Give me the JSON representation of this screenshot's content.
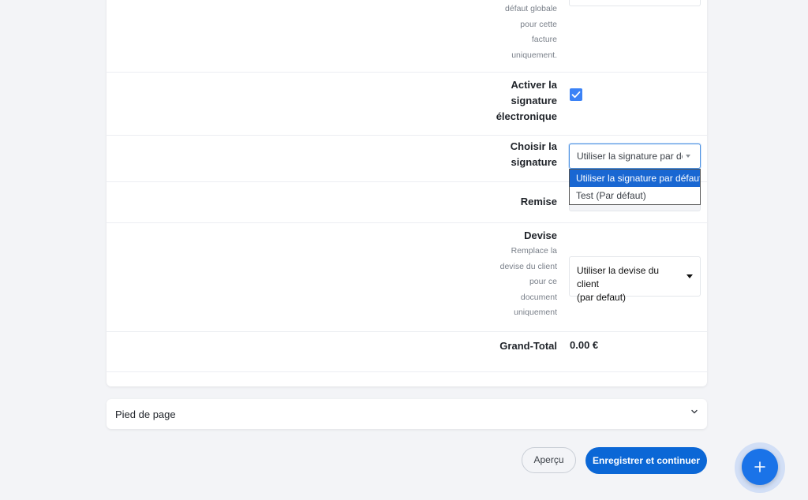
{
  "form": {
    "discount_help": [
      "défaut globale",
      "pour cette",
      "facture",
      "uniquement."
    ],
    "esign": {
      "label": [
        "Activer la",
        "signature",
        "électronique"
      ],
      "checked": true
    },
    "signature": {
      "label": [
        "Choisir la",
        "signature"
      ],
      "selected": "Utiliser la signature par défaut",
      "options": [
        "Utiliser la signature par défaut",
        "Test (Par défaut)"
      ]
    },
    "remise": {
      "label": "Remise"
    },
    "devise": {
      "label": "Devise",
      "help": [
        "Remplace la",
        "devise du client",
        "pour ce",
        "document",
        "uniquement"
      ],
      "selected_lines": [
        "Utiliser la devise du client",
        "(par defaut)"
      ]
    },
    "grand_total": {
      "label": "Grand-Total",
      "value": "0.00 €"
    }
  },
  "footer_section": {
    "title": "Pied de page"
  },
  "actions": {
    "preview": "Aperçu",
    "save": "Enregistrer et continuer"
  },
  "fab": {
    "icon": "plus-icon"
  },
  "colors": {
    "primary": "#0b67d6",
    "checkbox": "#3b82f6",
    "dropdown_selected": "#1967d2"
  }
}
